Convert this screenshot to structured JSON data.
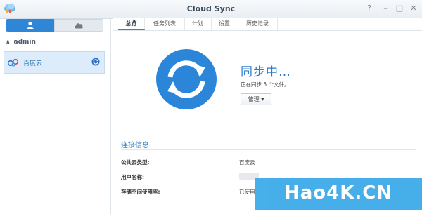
{
  "window": {
    "title": "Cloud Sync",
    "controls": [
      "?",
      "–",
      "□",
      "✕"
    ],
    "app_icon": "cloud-sync-app-icon"
  },
  "sidebar": {
    "segments": [
      {
        "icon": "user-icon",
        "active": true
      },
      {
        "icon": "cloud-icon",
        "active": false
      }
    ],
    "user": "admin",
    "connections": [
      {
        "label": "百度云",
        "icon": "baidu-cloud-icon",
        "status_icon": "sync-icon"
      }
    ]
  },
  "tabs": [
    "总览",
    "任务列表",
    "计划",
    "设置",
    "历史记录"
  ],
  "active_tab": 0,
  "status": {
    "title": "同步中…",
    "subtitle": "正在同步 5 个文件。",
    "manage_button": "管理"
  },
  "connection_info": {
    "title": "连接信息",
    "rows": [
      {
        "label": "公共云类型:",
        "value": "百度云"
      },
      {
        "label": "用户名称:",
        "value": ""
      },
      {
        "label": "存储空间使用率:",
        "value": "已使用"
      }
    ]
  },
  "watermark": "Hao4K.CN",
  "colors": {
    "accent": "#2f86d6",
    "sync_circle": "#2b86da",
    "watermark": "#37a8e8"
  }
}
